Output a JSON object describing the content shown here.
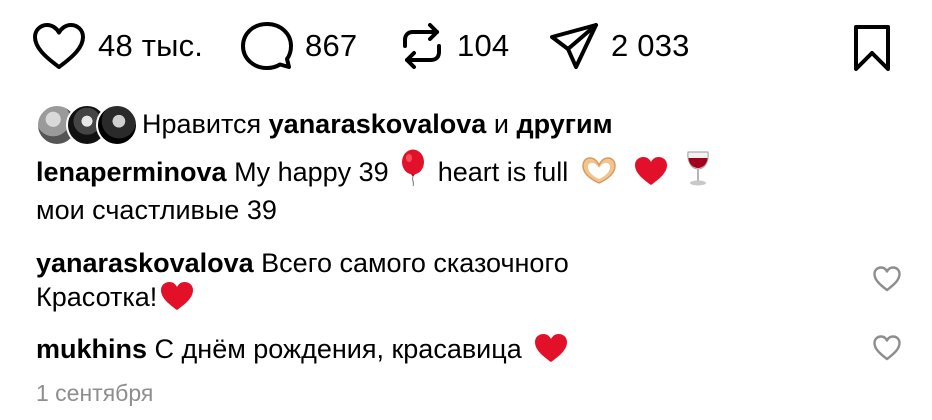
{
  "actions": {
    "likes": "48 тыс.",
    "comments": "867",
    "reposts": "104",
    "shares": "2 033"
  },
  "liked_by": {
    "prefix": "Нравится",
    "user": "yanaraskovalova",
    "joiner": "и",
    "others": "другим"
  },
  "caption": {
    "user": "lenaperminova",
    "text_part1": "My happy 39",
    "text_part2": "heart is full",
    "line2": "мои счастливые 39"
  },
  "comments": [
    {
      "user": "yanaraskovalova",
      "text": "Всего самого сказочного",
      "line2": "Красотка!"
    },
    {
      "user": "mukhins",
      "text": "С днём рождения, красавица"
    }
  ],
  "date": "1 сентября",
  "colors": {
    "text": "#000000",
    "muted": "#8e8e8e",
    "heart_red": "#e3102a"
  },
  "icons": [
    "heart-icon",
    "comment-icon",
    "repost-icon",
    "send-icon",
    "bookmark-icon"
  ]
}
